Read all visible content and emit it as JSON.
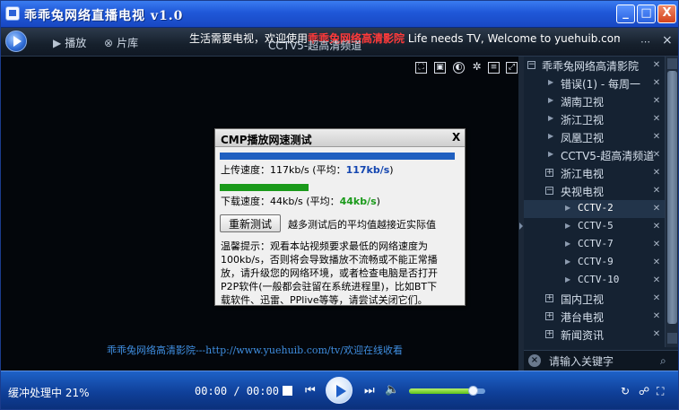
{
  "window": {
    "title": "乖乖兔网络直播电视 v1.0",
    "controls": {
      "minimize": "_",
      "maximize": "□",
      "close": "X"
    }
  },
  "toolbar": {
    "play_label": "播放",
    "library_label": "片库",
    "marquee_prefix": "生活需要电视，欢迎使用",
    "marquee_highlight": "乖乖兔网络高清影院",
    "marquee_suffix": " Life needs TV, Welcome to yuehuib.com |",
    "now_playing": "CCTV5-超高清频道",
    "right_close": "×"
  },
  "video": {
    "footer": "乖乖兔网络高清影院---http://www.yuehuib.com/tv/欢迎在线收看",
    "overlay_icons": [
      "fullscreen-icon",
      "window-icon",
      "contrast-icon",
      "settings-icon",
      "list-icon",
      "expand-icon"
    ]
  },
  "playlist": {
    "items": [
      {
        "label": "乖乖兔网络高清影院",
        "type": "group",
        "expanded": true
      },
      {
        "label": "错误(1) - 每周一",
        "type": "item"
      },
      {
        "label": "湖南卫视",
        "type": "item"
      },
      {
        "label": "浙江卫视",
        "type": "item"
      },
      {
        "label": "凤凰卫视",
        "type": "item"
      },
      {
        "label": "CCTV5-超高清频道",
        "type": "item"
      },
      {
        "label": "浙江电视",
        "type": "group",
        "expanded": false
      },
      {
        "label": "央视电视",
        "type": "group",
        "expanded": true
      },
      {
        "label": "CCTV-2",
        "type": "child",
        "selected": true
      },
      {
        "label": "CCTV-5",
        "type": "child"
      },
      {
        "label": "CCTV-7",
        "type": "child"
      },
      {
        "label": "CCTV-9",
        "type": "child"
      },
      {
        "label": "CCTV-10",
        "type": "child"
      },
      {
        "label": "国内卫视",
        "type": "group",
        "expanded": false
      },
      {
        "label": "港台电视",
        "type": "group",
        "expanded": false
      },
      {
        "label": "新闻资讯",
        "type": "group",
        "expanded": false
      }
    ],
    "search_placeholder": "请输入关键字"
  },
  "status": {
    "buffering": "缓冲处理中 21%",
    "time": "00:00 / 00:00",
    "volume_level": 0.85
  },
  "dialog": {
    "title": "CMP播放网速测试",
    "close": "X",
    "upload_label": "上传速度：117kb/s (平均：",
    "upload_avg": "117kb/s",
    "upload_close": ")",
    "upload_level": 0.98,
    "download_label": "下载速度：44kb/s (平均：",
    "download_avg": "44kb/s",
    "download_close": ")",
    "download_level": 0.37,
    "retest_button": "重新测试",
    "retest_hint": "越多测试后的平均值越接近实际值",
    "tip_lines": [
      "温馨提示：观看本站视频要求最低的网络速度为",
      "100kb/s，否则将会导致播放不流畅或不能正常播",
      "放，请升级您的网络环境，或者检查电脑是否打开",
      "P2P软件(一般都会驻留在系统进程里)，比如BT下",
      "载软件、迅雷、PPlive等等，请尝试关闭它们。"
    ]
  },
  "colors": {
    "title_bar": "#1f57d8",
    "marquee_highlight": "#ff3a3a",
    "upload_bar": "#1f5fc0",
    "download_bar": "#1a9a1a",
    "footer_link": "#3f8ee0"
  }
}
